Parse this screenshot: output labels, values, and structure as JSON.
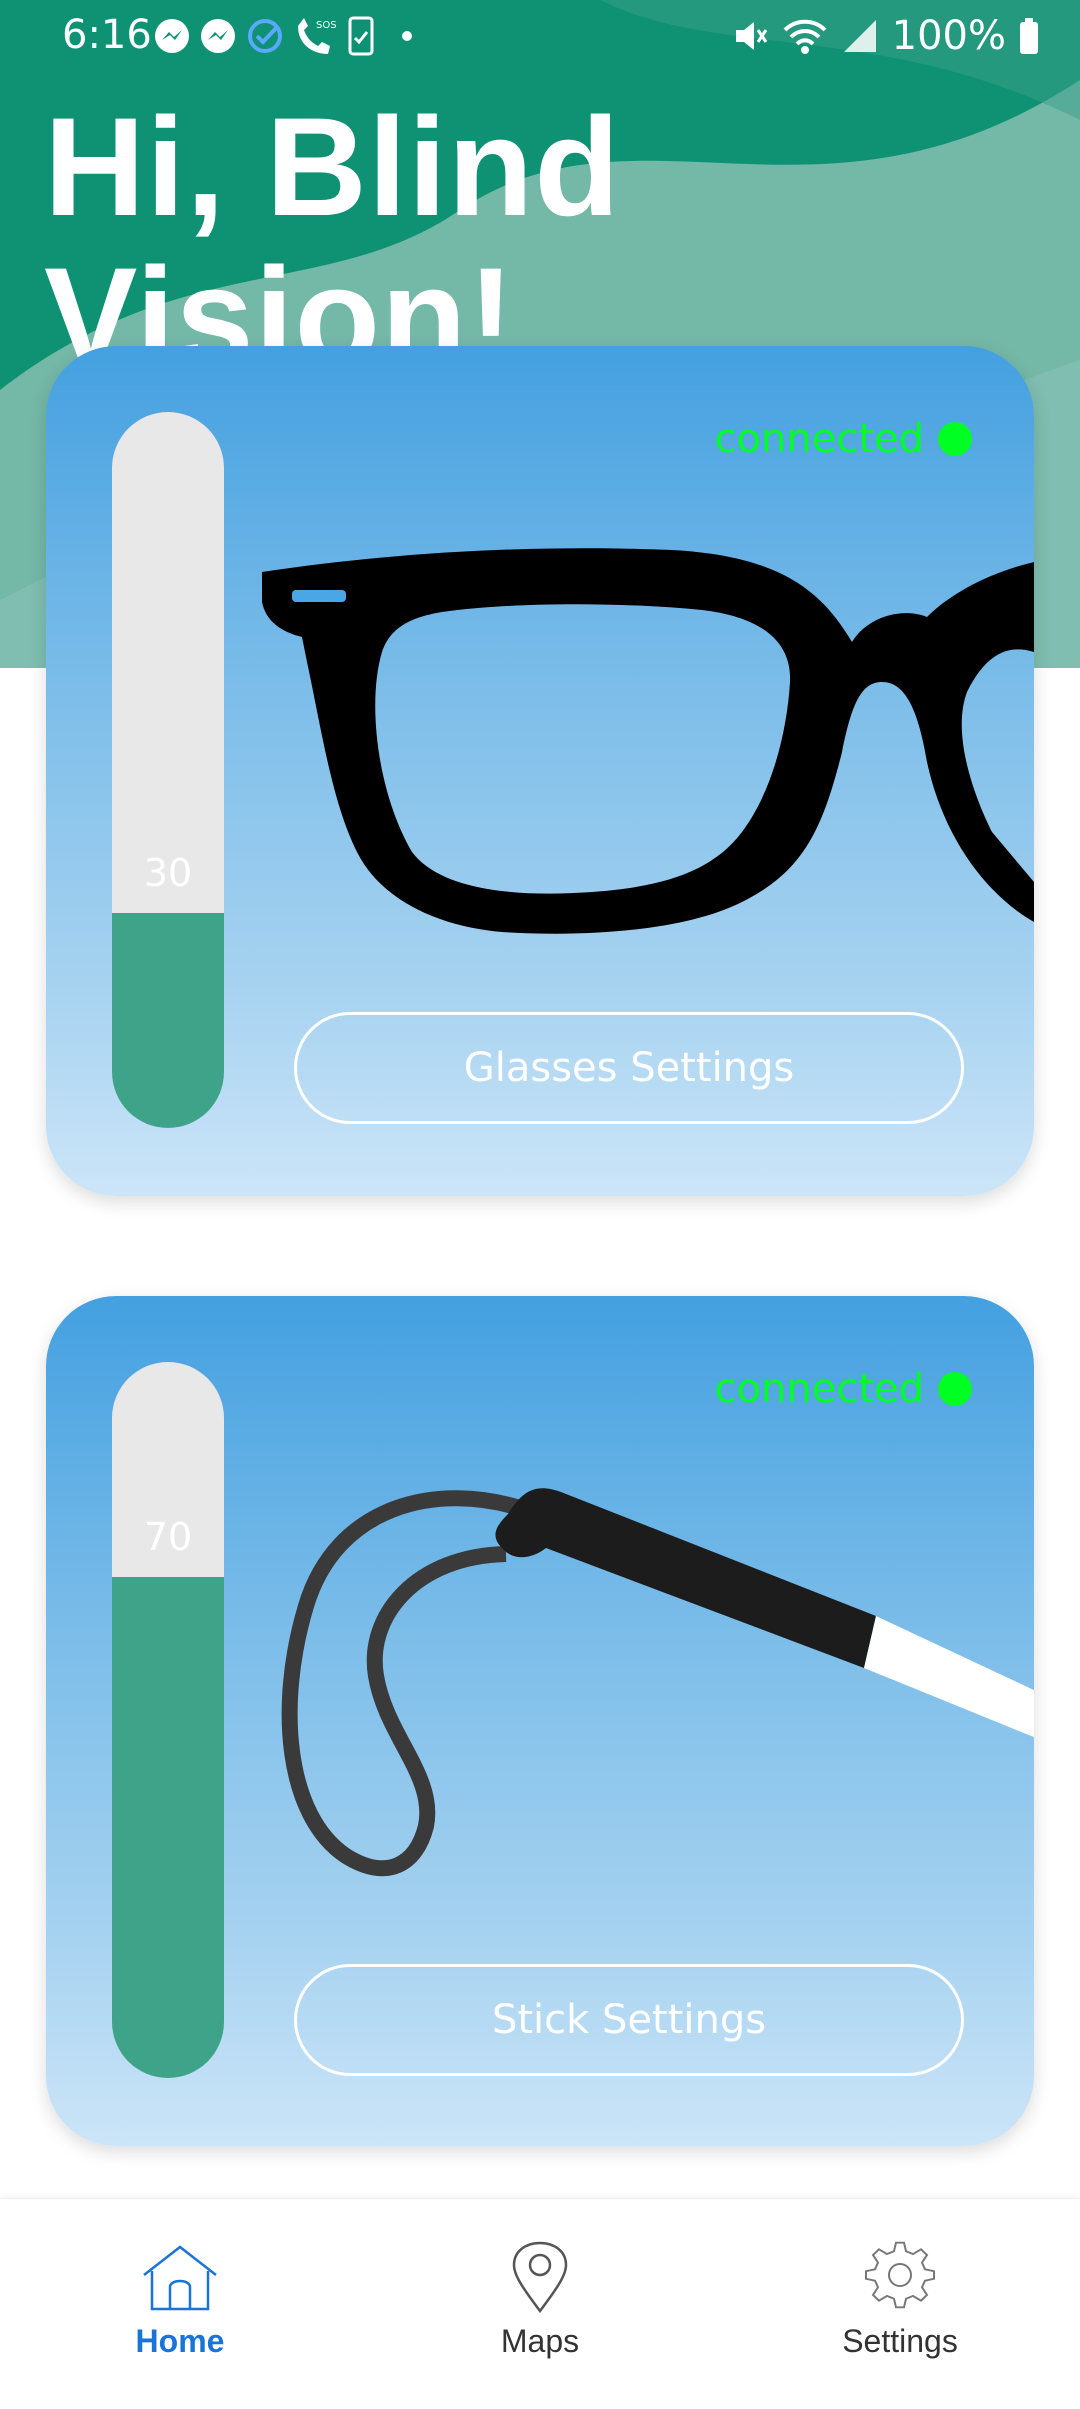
{
  "status_bar": {
    "time": "6:16",
    "battery": "100%",
    "notification_icons": [
      "messenger-icon",
      "messenger-icon",
      "check-circle-icon",
      "phone-sos-icon",
      "phone-task-icon",
      "dot-icon"
    ],
    "system_icons": [
      "mute-icon",
      "wifi-icon",
      "signal-icon",
      "battery-icon"
    ]
  },
  "header": {
    "greeting": "Hi, Blind Vision!",
    "colors": {
      "primary": "#0e9273",
      "wave": "#74b8a8",
      "wave_light": "#a9d3c8"
    }
  },
  "devices": [
    {
      "id": "glasses",
      "status": "connected",
      "battery_level": 30,
      "battery_label": "30",
      "button_label": "Glasses Settings",
      "image_icon": "glasses-icon"
    },
    {
      "id": "stick",
      "status": "connected",
      "battery_level": 70,
      "battery_label": "70",
      "button_label": "Stick Settings",
      "image_icon": "white-cane-icon"
    }
  ],
  "colors": {
    "connected": "#00ff22",
    "battery_fill": "#3fa38a",
    "battery_empty": "#e8e8e8",
    "card_top": "#44a0e0",
    "card_bottom": "#cce5f8",
    "nav_active": "#1a73d9"
  },
  "nav": {
    "items": [
      {
        "label": "Home",
        "icon": "home-icon",
        "active": true
      },
      {
        "label": "Maps",
        "icon": "map-pin-icon",
        "active": false
      },
      {
        "label": "Settings",
        "icon": "gear-icon",
        "active": false
      }
    ]
  }
}
